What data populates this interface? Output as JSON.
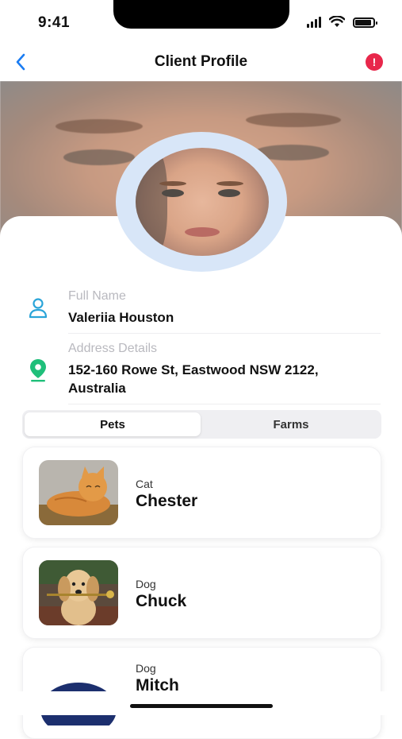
{
  "status_bar": {
    "time": "9:41"
  },
  "nav": {
    "title": "Client Profile",
    "alert_glyph": "!"
  },
  "profile": {
    "full_name_label": "Full Name",
    "full_name": "Valeriia Houston",
    "address_label": "Address Details",
    "address_line1": "152-160 Rowe St, Eastwood NSW 2122,",
    "address_line2": "Australia"
  },
  "tabs": {
    "pets": "Pets",
    "farms": "Farms",
    "selected": "Pets"
  },
  "pets": [
    {
      "type": "Cat",
      "name": "Chester",
      "icon": "cat-photo"
    },
    {
      "type": "Dog",
      "name": "Chuck",
      "icon": "dog-photo"
    },
    {
      "type": "Dog",
      "name": "Mitch",
      "icon": "dog-avatar"
    }
  ],
  "colors": {
    "accent": "#1a7cf2",
    "alert": "#e8274b",
    "location": "#1fbf7a",
    "person": "#2aa4d8",
    "avatar_ring": "#d8e6f8"
  }
}
